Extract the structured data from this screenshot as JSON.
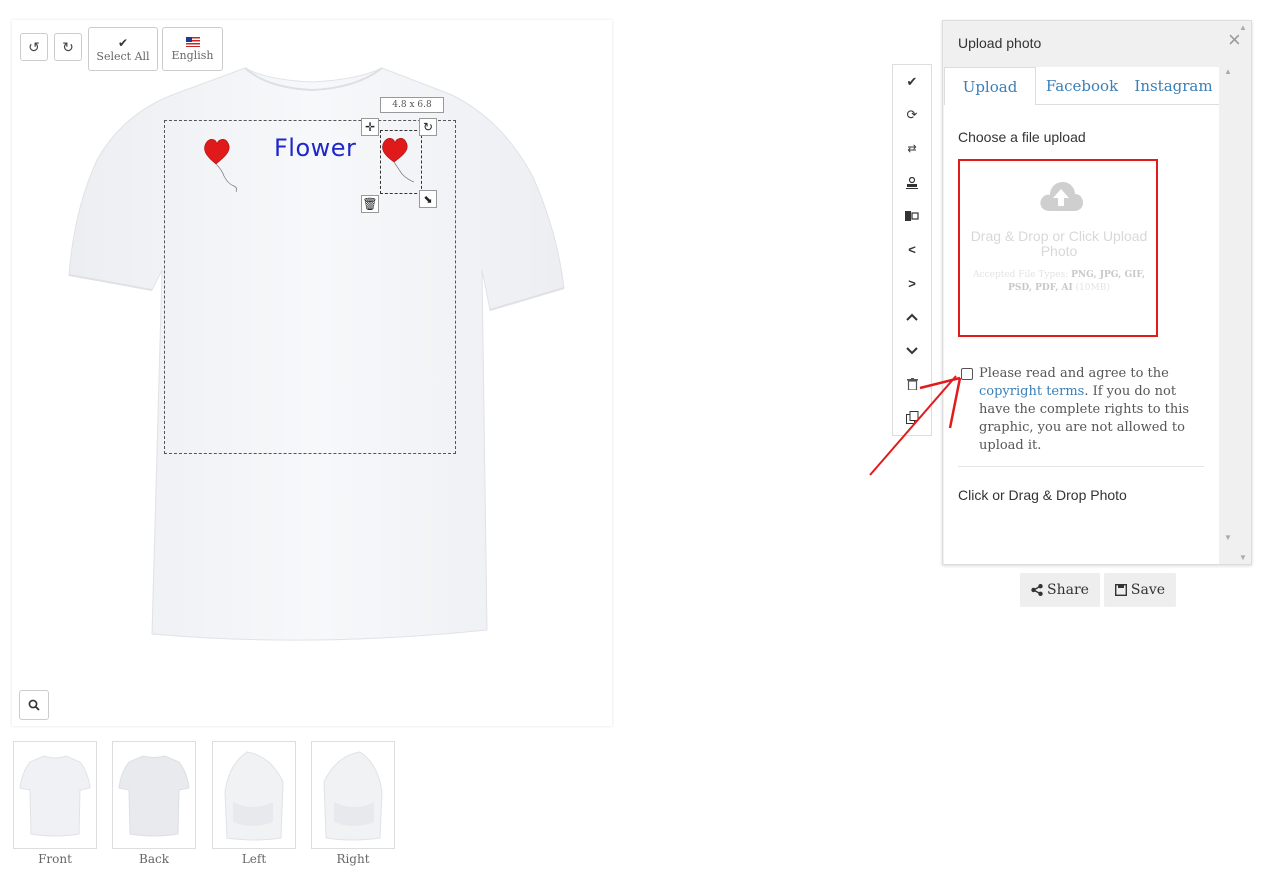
{
  "toolbar": {
    "undo_icon": "undo-icon",
    "redo_icon": "redo-icon",
    "select_all_label": "Select All",
    "language_label": "English"
  },
  "design": {
    "text_layer": "Flower",
    "text_color": "#1f27c9",
    "size_label": "4.8 x 6.8",
    "selection_color": "#333333"
  },
  "views": [
    {
      "label": "Front"
    },
    {
      "label": "Back"
    },
    {
      "label": "Left"
    },
    {
      "label": "Right"
    }
  ],
  "side_tools": [
    "check-icon",
    "refresh-icon",
    "swap-icon",
    "stamp-icon",
    "align-icon",
    "chevron-left-icon",
    "chevron-right-icon",
    "chevron-up-icon",
    "chevron-down-icon",
    "trash-icon",
    "duplicate-icon"
  ],
  "panel": {
    "title": "Upload photo",
    "tabs": [
      {
        "label": "Upload",
        "active": true
      },
      {
        "label": "Facebook",
        "active": false
      },
      {
        "label": "Instagram",
        "active": false
      }
    ],
    "choose_label": "Choose a file upload",
    "drop_text": "Drag & Drop or Click Upload Photo",
    "accepted_prefix": "Accepted File Types:",
    "accepted_types": "PNG, JPG, GIF, PSD, PDF, AI",
    "accepted_size": "(10MB)",
    "agree_before": "Please read and agree to the",
    "agree_link": "copyright terms",
    "agree_after": ". If you do not have the complete rights to this graphic, you are not allowed to upload it.",
    "click_drag_label": "Click or Drag & Drop Photo"
  },
  "actions": {
    "share_label": "Share",
    "save_label": "Save"
  },
  "colors": {
    "link": "#3a7fb6",
    "highlight": "#e21b1b"
  }
}
